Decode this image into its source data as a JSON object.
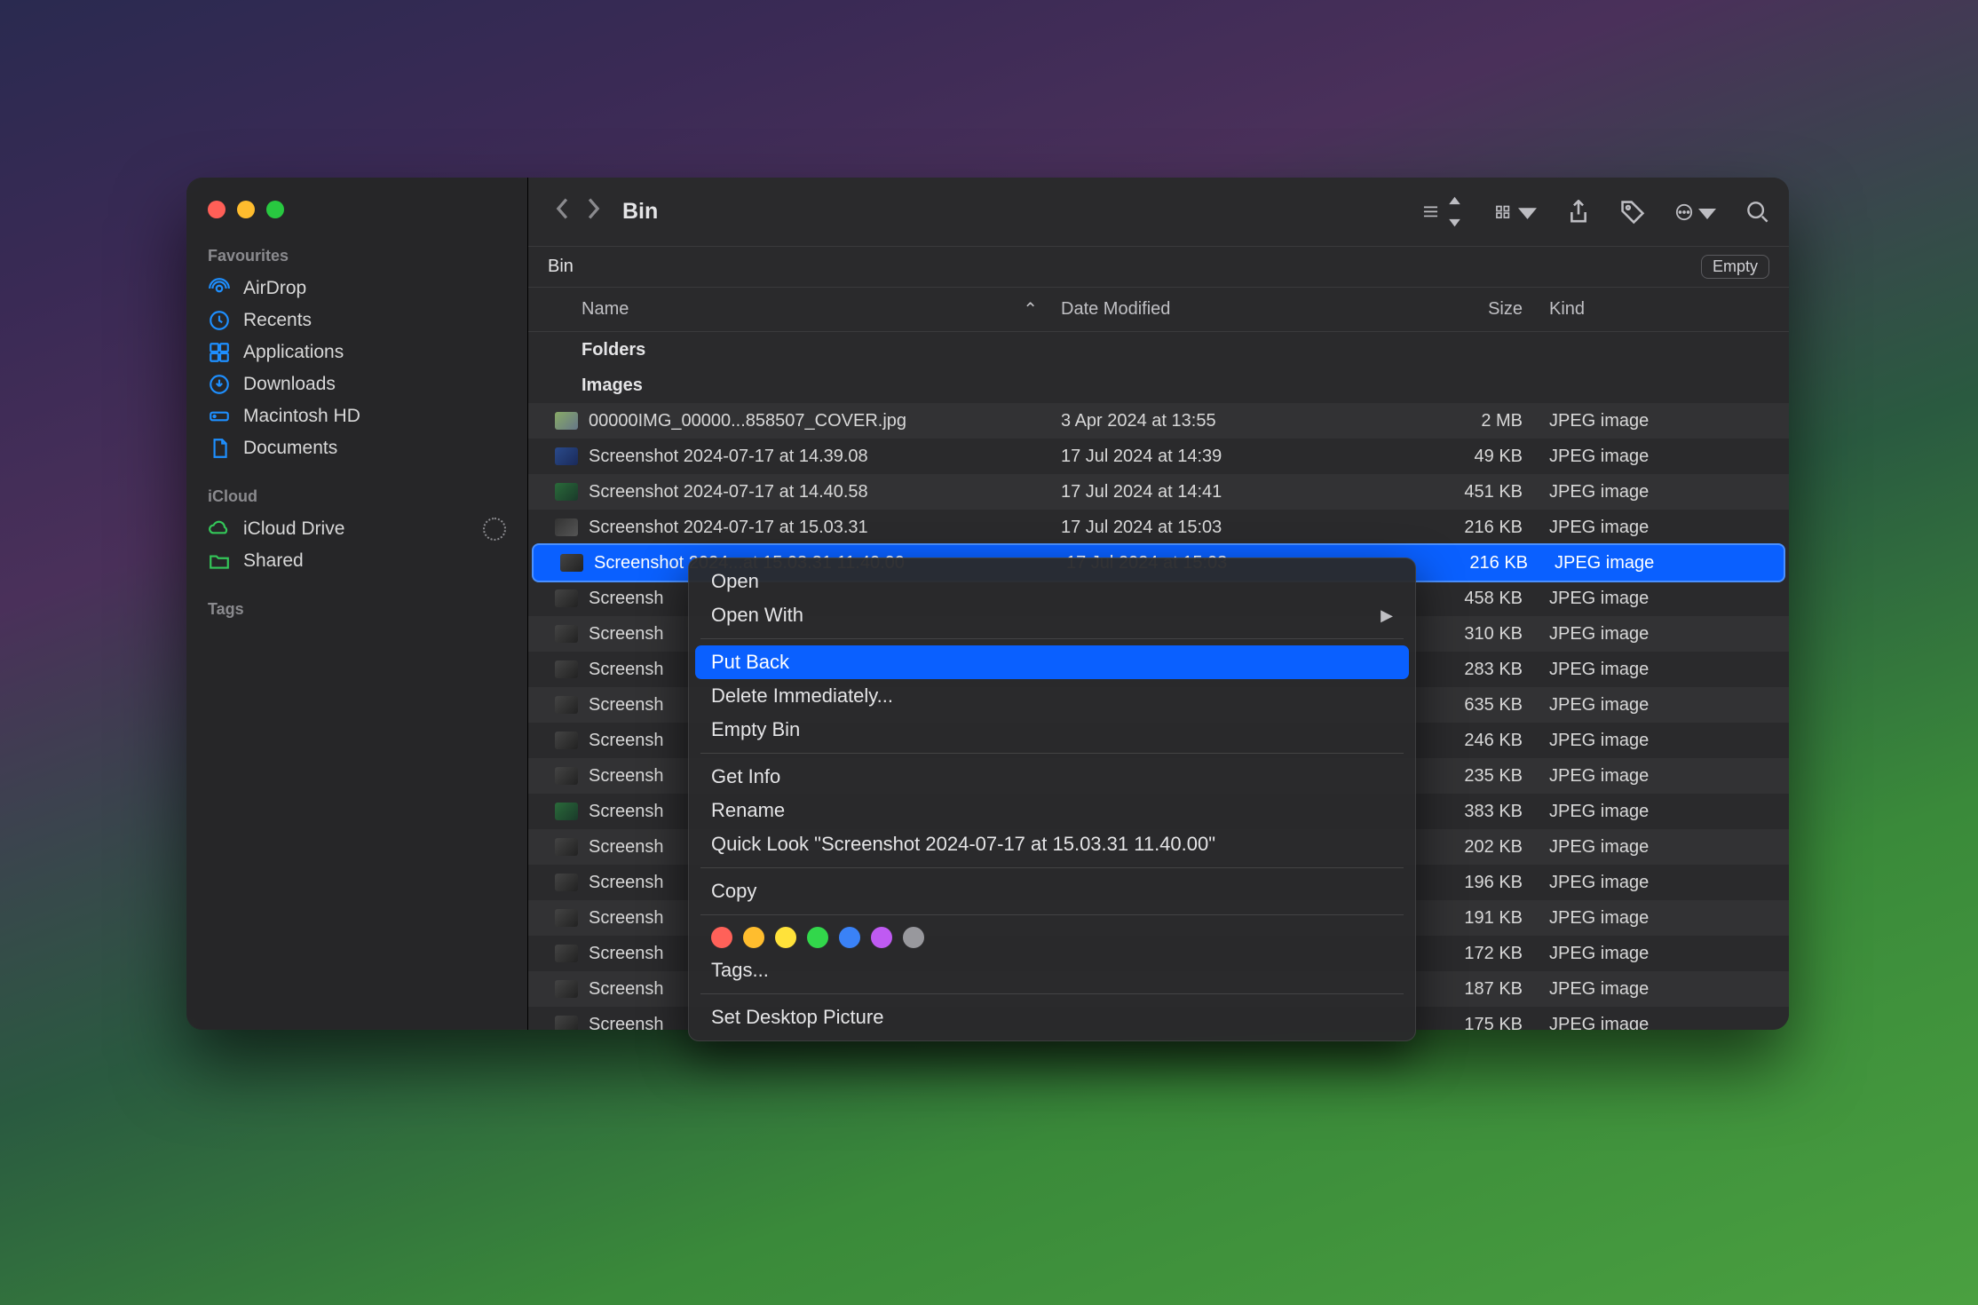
{
  "window_title": "Bin",
  "toolbar": {
    "back": "‹",
    "forward": "›"
  },
  "location": {
    "label": "Bin",
    "empty_button": "Empty"
  },
  "columns": {
    "name": "Name",
    "date": "Date Modified",
    "size": "Size",
    "kind": "Kind"
  },
  "group": {
    "folders": "Folders",
    "images": "Images"
  },
  "sidebar": {
    "favourites_label": "Favourites",
    "icloud_label": "iCloud",
    "tags_label": "Tags",
    "items": {
      "airdrop": "AirDrop",
      "recents": "Recents",
      "applications": "Applications",
      "downloads": "Downloads",
      "macintosh_hd": "Macintosh HD",
      "documents": "Documents",
      "icloud_drive": "iCloud Drive",
      "shared": "Shared"
    }
  },
  "files": [
    {
      "name": "00000IMG_00000...858507_COVER.jpg",
      "date": "3 Apr 2024 at 13:55",
      "size": "2 MB",
      "kind": "JPEG image",
      "icon": "img1"
    },
    {
      "name": "Screenshot 2024-07-17 at 14.39.08",
      "date": "17 Jul 2024 at 14:39",
      "size": "49 KB",
      "kind": "JPEG image",
      "icon": "ss1"
    },
    {
      "name": "Screenshot 2024-07-17 at 14.40.58",
      "date": "17 Jul 2024 at 14:41",
      "size": "451 KB",
      "kind": "JPEG image",
      "icon": "ss2"
    },
    {
      "name": "Screenshot 2024-07-17 at 15.03.31",
      "date": "17 Jul 2024 at 15:03",
      "size": "216 KB",
      "kind": "JPEG image",
      "icon": "ss3"
    },
    {
      "name": "Screenshot 2024...at 15.03.31 11.40.00",
      "date": "17 Jul 2024 at 15:03",
      "size": "216 KB",
      "kind": "JPEG image",
      "icon": "ss4",
      "selected": true
    },
    {
      "name": "Screensh",
      "date": "",
      "size": "458 KB",
      "kind": "JPEG image",
      "icon": "ss4"
    },
    {
      "name": "Screensh",
      "date": "",
      "size": "310 KB",
      "kind": "JPEG image",
      "icon": "ss4"
    },
    {
      "name": "Screensh",
      "date": "",
      "size": "283 KB",
      "kind": "JPEG image",
      "icon": "ss4"
    },
    {
      "name": "Screensh",
      "date": "",
      "size": "635 KB",
      "kind": "JPEG image",
      "icon": "ss4"
    },
    {
      "name": "Screensh",
      "date": "",
      "size": "246 KB",
      "kind": "JPEG image",
      "icon": "ss4"
    },
    {
      "name": "Screensh",
      "date": "",
      "size": "235 KB",
      "kind": "JPEG image",
      "icon": "ss4"
    },
    {
      "name": "Screensh",
      "date": "",
      "size": "383 KB",
      "kind": "JPEG image",
      "icon": "ss2"
    },
    {
      "name": "Screensh",
      "date": "",
      "size": "202 KB",
      "kind": "JPEG image",
      "icon": "ss4"
    },
    {
      "name": "Screensh",
      "date": "",
      "size": "196 KB",
      "kind": "JPEG image",
      "icon": "ss4"
    },
    {
      "name": "Screensh",
      "date": "",
      "size": "191 KB",
      "kind": "JPEG image",
      "icon": "ss4"
    },
    {
      "name": "Screensh",
      "date": "",
      "size": "172 KB",
      "kind": "JPEG image",
      "icon": "ss4"
    },
    {
      "name": "Screensh",
      "date": "",
      "size": "187 KB",
      "kind": "JPEG image",
      "icon": "ss4"
    },
    {
      "name": "Screensh",
      "date": "",
      "size": "175 KB",
      "kind": "JPEG image",
      "icon": "ss4"
    }
  ],
  "context_menu": {
    "open": "Open",
    "open_with": "Open With",
    "put_back": "Put Back",
    "delete_immediately": "Delete Immediately...",
    "empty_bin": "Empty Bin",
    "get_info": "Get Info",
    "rename": "Rename",
    "quick_look": "Quick Look \"Screenshot 2024-07-17 at 15.03.31 11.40.00\"",
    "copy": "Copy",
    "tags": "Tags...",
    "set_desktop": "Set Desktop Picture",
    "tag_colors": [
      "#ff6159",
      "#ffbd2e",
      "#ffe23a",
      "#32d74b",
      "#3a82f7",
      "#bf5af2",
      "#98989d"
    ]
  }
}
